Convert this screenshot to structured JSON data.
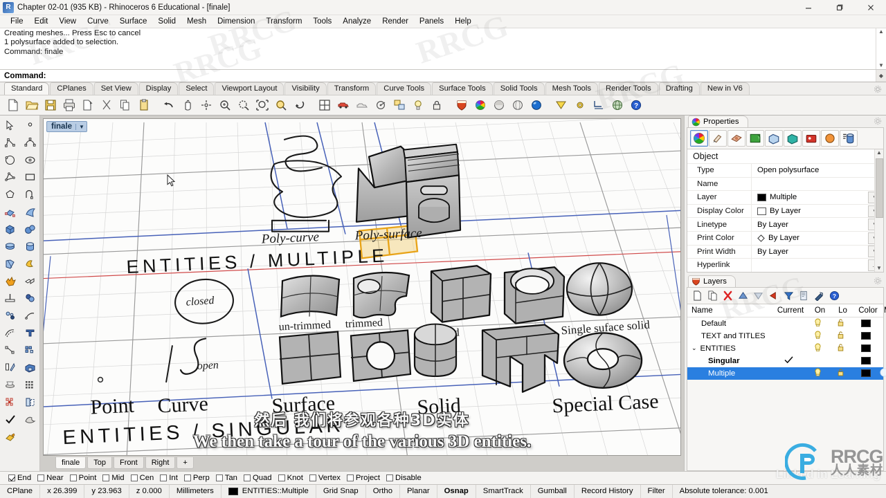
{
  "window": {
    "title": "Chapter 02-01 (935 KB) - Rhinoceros 6 Educational - [finale]",
    "app_icon": "rhino-icon",
    "minimize": "—",
    "maximize": "❐",
    "close": "✕"
  },
  "menubar": {
    "items": [
      "File",
      "Edit",
      "View",
      "Curve",
      "Surface",
      "Solid",
      "Mesh",
      "Dimension",
      "Transform",
      "Tools",
      "Analyze",
      "Render",
      "Panels",
      "Help"
    ]
  },
  "command": {
    "history": [
      "Creating meshes... Press Esc to cancel",
      "1 polysurface added to selection.",
      "Command: finale"
    ],
    "prompt_label": "Command:",
    "prompt_value": ""
  },
  "toolbar_tabs": {
    "active": "Standard",
    "items": [
      "Standard",
      "CPlanes",
      "Set View",
      "Display",
      "Select",
      "Viewport Layout",
      "Visibility",
      "Transform",
      "Curve Tools",
      "Surface Tools",
      "Solid Tools",
      "Mesh Tools",
      "Render Tools",
      "Drafting",
      "New in V6"
    ]
  },
  "standard_toolbar": {
    "icons": [
      "new-file-icon",
      "open-folder-icon",
      "save-icon",
      "print-icon",
      "copy-to-clipboard-icon",
      "cut-icon",
      "copy-icon",
      "paste-icon",
      "undo-icon",
      "pan-icon",
      "rotate-view-icon",
      "zoom-in-icon",
      "zoom-window-icon",
      "zoom-extents-icon",
      "zoom-selected-icon",
      "undo-view-icon",
      "viewport-layout-icon",
      "render-icon",
      "render-preview-icon",
      "render-properties-icon",
      "layer-icon",
      "light-icon",
      "lock-icon",
      "shield-icon",
      "color-wheel-icon",
      "shaded-sphere-icon",
      "ghosted-sphere-icon",
      "rendered-sphere-icon",
      "isocurve-icon",
      "gear-icon",
      "dimension-icon",
      "globe-icon",
      "help-icon"
    ]
  },
  "left_toolbar": {
    "icons": [
      "select-arrow-icon",
      "point-icon",
      "polyline-icon",
      "control-point-curve-icon",
      "circle-icon",
      "ellipse-icon",
      "polygon-icon",
      "rectangle-icon",
      "polygon-ngon-icon",
      "arc-icon",
      "surface-from-points-icon",
      "surface-sweep-icon",
      "box-icon",
      "sphere-icon",
      "ellipsoid-icon",
      "cylinder-icon",
      "revolve-icon",
      "boolean-icon",
      "explode-icon",
      "join-icon",
      "split-icon",
      "trim-icon",
      "fillet-icon",
      "chamfer-icon",
      "offset-icon",
      "blend-icon",
      "text-icon",
      "dimension-linear-icon",
      "array-icon",
      "scale-icon",
      "extrude-icon",
      "cap-icon",
      "grid-icon",
      "grid-snap-icon",
      "mirror-icon",
      "check-icon",
      "mesh-icon",
      "gradient-icon"
    ]
  },
  "viewport": {
    "label": "finale",
    "dropdown_caret": "▼",
    "tabs": [
      "finale",
      "Top",
      "Front",
      "Right"
    ],
    "active_tab": "finale",
    "add_tab": "+",
    "scene": {
      "section_titles": [
        "ENTITIES / MULTIPLE",
        "ENTITIES / SINGULAR"
      ],
      "labels_top": [
        "Poly-curve",
        "Poly-surface"
      ],
      "labels_bottom": [
        "Point",
        "Curve",
        "Surface",
        "Solid",
        "Special Case"
      ],
      "sub_labels": [
        "closed",
        "open",
        "un-trimmed",
        "trimmed",
        "closed",
        "open",
        "Single suface solid"
      ],
      "selected_object_color": "#e8a317"
    }
  },
  "subtitles": {
    "chinese": "然后 我们将参观各种3D实体",
    "english": "We then take a tour of the various 3D entities."
  },
  "properties_panel": {
    "title": "Properties",
    "tab_icon": "color-wheel-icon",
    "gear_icon": "gear-icon",
    "toolbar_icons": [
      "object-properties-icon",
      "material-icon",
      "texture-mapping-icon",
      "display-icon",
      "view-icon",
      "render-mesh-icon",
      "environment-icon",
      "sun-icon",
      "detail-icon"
    ],
    "active_icon": "object-properties-icon",
    "section": "Object",
    "rows": [
      {
        "key": "Type",
        "value": "Open polysurface",
        "has_dropdown": false,
        "swatch": null
      },
      {
        "key": "Name",
        "value": "",
        "has_dropdown": false,
        "swatch": null
      },
      {
        "key": "Layer",
        "value": "Multiple",
        "has_dropdown": true,
        "swatch": "#000000"
      },
      {
        "key": "Display Color",
        "value": "By Layer",
        "has_dropdown": true,
        "swatch": "#ffffff"
      },
      {
        "key": "Linetype",
        "value": "By Layer",
        "has_dropdown": true,
        "swatch": null
      },
      {
        "key": "Print Color",
        "value": "By Layer",
        "has_dropdown": true,
        "swatch": "diamond"
      },
      {
        "key": "Print Width",
        "value": "By Layer",
        "has_dropdown": true,
        "swatch": null
      },
      {
        "key": "Hyperlink",
        "value": "",
        "has_dropdown": false,
        "swatch": null,
        "ellipsis": "..."
      }
    ]
  },
  "layers_panel": {
    "title": "Layers",
    "tab_icon": "layers-icon",
    "gear_icon": "gear-icon",
    "toolbar_icons": [
      "new-layer-icon",
      "new-sublayer-icon",
      "delete-layer-icon",
      "move-up-icon",
      "move-down-icon",
      "filter-arrow-icon",
      "filter-icon",
      "select-objects-icon",
      "tools-icon",
      "help-icon"
    ],
    "columns": [
      "Name",
      "Current",
      "On",
      "Lo",
      "Color",
      "Ma"
    ],
    "rows": [
      {
        "name": "Default",
        "indent": 1,
        "current": false,
        "on": true,
        "lock": true,
        "color": "#000000",
        "expander": null,
        "bold": false,
        "selected": false,
        "material": false
      },
      {
        "name": "TEXT and TITLES",
        "indent": 1,
        "current": false,
        "on": true,
        "lock": true,
        "color": "#000000",
        "expander": null,
        "bold": false,
        "selected": false,
        "material": false
      },
      {
        "name": "ENTITIES",
        "indent": 0,
        "current": false,
        "on": true,
        "lock": true,
        "color": "#000000",
        "expander": "⌄",
        "bold": false,
        "selected": false,
        "material": false
      },
      {
        "name": "Singular",
        "indent": 2,
        "current": true,
        "on": false,
        "lock": false,
        "color": "#000000",
        "expander": null,
        "bold": true,
        "selected": false,
        "material": false
      },
      {
        "name": "Multiple",
        "indent": 2,
        "current": false,
        "on": true,
        "lock": true,
        "color": "#000000",
        "expander": null,
        "bold": false,
        "selected": true,
        "material": true
      }
    ],
    "selection_color": "#2a7fe0"
  },
  "osnap_bar": {
    "items": [
      {
        "label": "End",
        "checked": true
      },
      {
        "label": "Near",
        "checked": false
      },
      {
        "label": "Point",
        "checked": false
      },
      {
        "label": "Mid",
        "checked": false
      },
      {
        "label": "Cen",
        "checked": false
      },
      {
        "label": "Int",
        "checked": false
      },
      {
        "label": "Perp",
        "checked": false
      },
      {
        "label": "Tan",
        "checked": false
      },
      {
        "label": "Quad",
        "checked": false
      },
      {
        "label": "Knot",
        "checked": false
      },
      {
        "label": "Vertex",
        "checked": false
      },
      {
        "label": "Project",
        "checked": false
      },
      {
        "label": "Disable",
        "checked": false
      }
    ]
  },
  "statusbar": {
    "cplane": "CPlane",
    "x": "x 26.399",
    "y": "y 23.963",
    "z": "z 0.000",
    "units": "Millimeters",
    "layer_swatch": "#000000",
    "layer": "ENTITIES::Multiple",
    "toggles": [
      "Grid Snap",
      "Ortho",
      "Planar",
      "Osnap",
      "SmartTrack",
      "Gumball",
      "Record History",
      "Filter"
    ],
    "active_toggle": "Osnap",
    "tolerance": "Absolute tolerance: 0.001"
  },
  "watermarks": {
    "brand": "RRCG",
    "brand_cn": "人人素材",
    "platform": "Linked in Learning",
    "faint": "RRCG"
  }
}
